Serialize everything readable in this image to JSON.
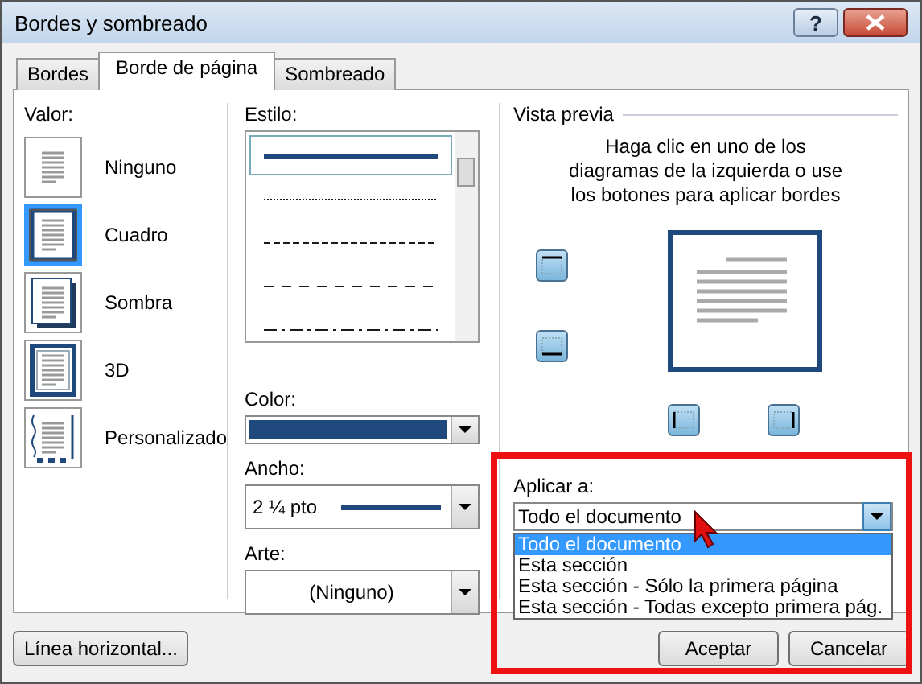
{
  "window": {
    "title": "Bordes y sombreado",
    "help_button": "?"
  },
  "tabs": [
    {
      "label": "Bordes",
      "selected": false
    },
    {
      "label": "Borde de página",
      "selected": true
    },
    {
      "label": "Sombreado",
      "selected": false
    }
  ],
  "setting": {
    "label": "Valor:",
    "options": [
      {
        "label": "Ninguno",
        "kind": "none",
        "selected": false
      },
      {
        "label": "Cuadro",
        "kind": "box",
        "selected": true
      },
      {
        "label": "Sombra",
        "kind": "shadow",
        "selected": false
      },
      {
        "label": "3D",
        "kind": "three-d",
        "selected": false
      },
      {
        "label": "Personalizado",
        "kind": "custom",
        "selected": false
      }
    ]
  },
  "style": {
    "label": "Estilo:",
    "line_styles": [
      {
        "kind": "solid",
        "selected": true
      },
      {
        "kind": "dotted",
        "selected": false
      },
      {
        "kind": "dashed",
        "selected": false
      },
      {
        "kind": "long-dashed",
        "selected": false
      },
      {
        "kind": "dash-dot",
        "selected": false
      }
    ]
  },
  "color": {
    "label": "Color:",
    "swatch": {
      "color": "#1f497d"
    }
  },
  "width": {
    "label": "Ancho:",
    "value": "2 ¼ pto"
  },
  "art": {
    "label": "Arte:",
    "value": "(Ninguno)"
  },
  "preview": {
    "label": "Vista previa",
    "hint": "Haga clic en uno de los diagramas de la izquierda o use los botones para aplicar bordes",
    "border_buttons": [
      {
        "kind": "top"
      },
      {
        "kind": "bottom"
      },
      {
        "kind": "left"
      },
      {
        "kind": "right"
      }
    ]
  },
  "apply_to": {
    "label": "Aplicar a:",
    "value": "Todo el documento",
    "expanded": true,
    "options": [
      {
        "label": "Todo el documento",
        "selected": true
      },
      {
        "label": "Esta sección",
        "selected": false
      },
      {
        "label": "Esta sección - Sólo la primera página",
        "selected": false
      },
      {
        "label": "Esta sección - Todas excepto primera pág.",
        "selected": false
      }
    ]
  },
  "buttons": [
    {
      "label": "Línea horizontal...",
      "kind": "left"
    },
    {
      "label": "Aceptar",
      "kind": "right"
    },
    {
      "label": "Cancelar",
      "kind": "right"
    }
  ]
}
